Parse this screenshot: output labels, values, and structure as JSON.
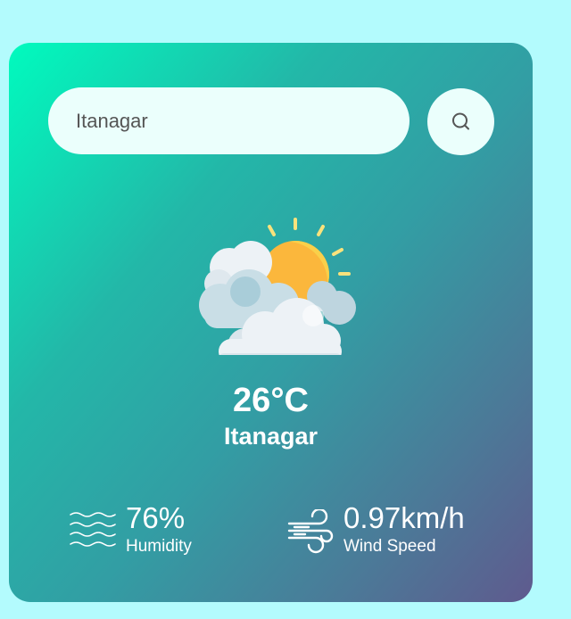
{
  "search": {
    "value": "Itanagar",
    "icon": "search-icon"
  },
  "weather": {
    "icon": "partly-cloudy-sun-icon",
    "temperature": "26°C",
    "city": "Itanagar"
  },
  "details": {
    "humidity": {
      "icon": "humidity-waves-icon",
      "value": "76%",
      "label": "Humidity"
    },
    "wind": {
      "icon": "wind-icon",
      "value": "0.97km/h",
      "label": "Wind Speed"
    }
  },
  "colors": {
    "page_background": "#b3fbfd",
    "gradient_start": "#00fbbe",
    "gradient_end": "#5f5a8e",
    "input_background": "#ebfffc",
    "text": "#ffffff"
  }
}
